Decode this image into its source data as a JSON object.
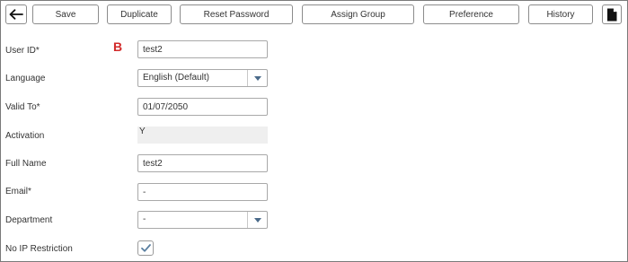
{
  "toolbar": {
    "back_icon": "back-arrow-icon",
    "save_label": "Save",
    "duplicate_label": "Duplicate",
    "reset_password_label": "Reset Password",
    "assign_group_label": "Assign Group",
    "preference_label": "Preference",
    "history_label": "History",
    "document_icon": "document-icon"
  },
  "annotation": {
    "marker": "B",
    "color": "#d22a2a"
  },
  "form": {
    "user_id": {
      "label": "User ID*",
      "value": "test2"
    },
    "language": {
      "label": "Language",
      "value": "English (Default)"
    },
    "valid_to": {
      "label": "Valid To*",
      "value": "01/07/2050"
    },
    "activation": {
      "label": "Activation",
      "value": "Y"
    },
    "full_name": {
      "label": "Full Name",
      "value": "test2"
    },
    "email": {
      "label": "Email*",
      "value": "-"
    },
    "department": {
      "label": "Department",
      "value": "-"
    },
    "no_ip_restriction": {
      "label": "No IP Restriction",
      "checked": true
    }
  },
  "colors": {
    "accent_check": "#5a7fa0",
    "border": "#a9a9a9",
    "readonly_bg": "#efefef"
  }
}
